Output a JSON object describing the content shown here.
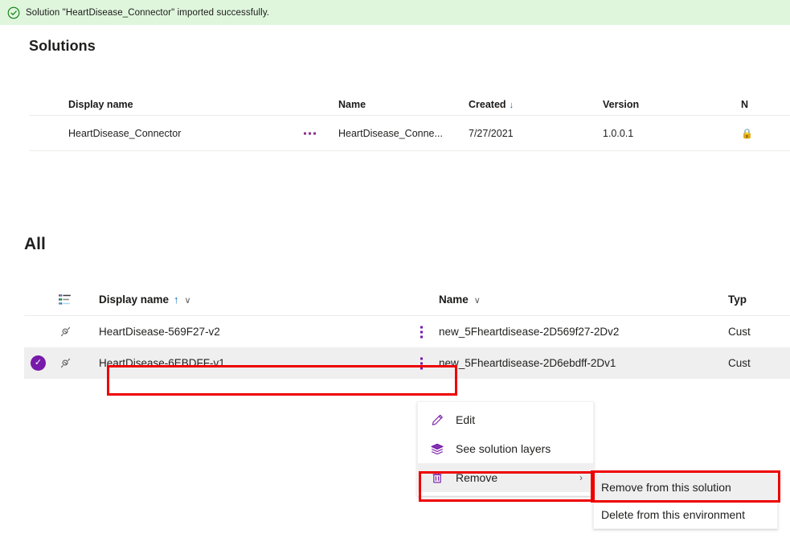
{
  "banner": {
    "icon": "check-circle-icon",
    "message": "Solution \"HeartDisease_Connector\" imported successfully.",
    "background": "#dff6dd",
    "icon_color": "#107c10"
  },
  "solutions_section": {
    "title": "Solutions",
    "columns": {
      "display_name": "Display name",
      "name": "Name",
      "created": "Created",
      "created_sort": "↓",
      "version": "Version",
      "next": "N"
    },
    "rows": [
      {
        "display_name": "HeartDisease_Connector",
        "name": "HeartDisease_Conne...",
        "created": "7/27/2021",
        "version": "1.0.0.1",
        "overflow": "more-options-icon"
      }
    ]
  },
  "all_section": {
    "title": "All",
    "columns": {
      "list_icon": "list-view-icon",
      "display_name": "Display name",
      "display_name_sort": "↑",
      "display_name_chevron": "∨",
      "name": "Name",
      "name_chevron": "∨",
      "type": "Typ"
    },
    "rows": [
      {
        "selected": false,
        "icon": "connector-icon",
        "display_name": "HeartDisease-569F27-v2",
        "name": "new_5Fheartdisease-2D569f27-2Dv2",
        "type": "Cust",
        "overflow": "more-options-icon"
      },
      {
        "selected": true,
        "icon": "connector-icon",
        "display_name": "HeartDisease-6EBDFF-v1",
        "name": "new_5Fheartdisease-2D6ebdff-2Dv1",
        "type": "Cust",
        "overflow": "more-options-icon"
      }
    ]
  },
  "context_menu": {
    "items": [
      {
        "icon": "pencil-icon",
        "label": "Edit",
        "highlighted": false,
        "has_submenu": false
      },
      {
        "icon": "layers-icon",
        "label": "See solution layers",
        "highlighted": false,
        "has_submenu": false
      },
      {
        "icon": "trash-icon",
        "label": "Remove",
        "highlighted": true,
        "has_submenu": true,
        "submenu_arrow": "›"
      }
    ]
  },
  "submenu": {
    "items": [
      {
        "label": "Remove from this solution",
        "highlighted": true
      },
      {
        "label": "Delete from this environment",
        "highlighted": false
      }
    ]
  },
  "annotations": {
    "highlight_color": "#ee0000",
    "boxes": [
      "selected-row-display-name",
      "remove-menu-item",
      "remove-from-this-solution-item"
    ]
  },
  "theme": {
    "accent_purple": "#7719aa",
    "link_blue": "#0f6cbd",
    "row_selected_bg": "#efefef"
  }
}
